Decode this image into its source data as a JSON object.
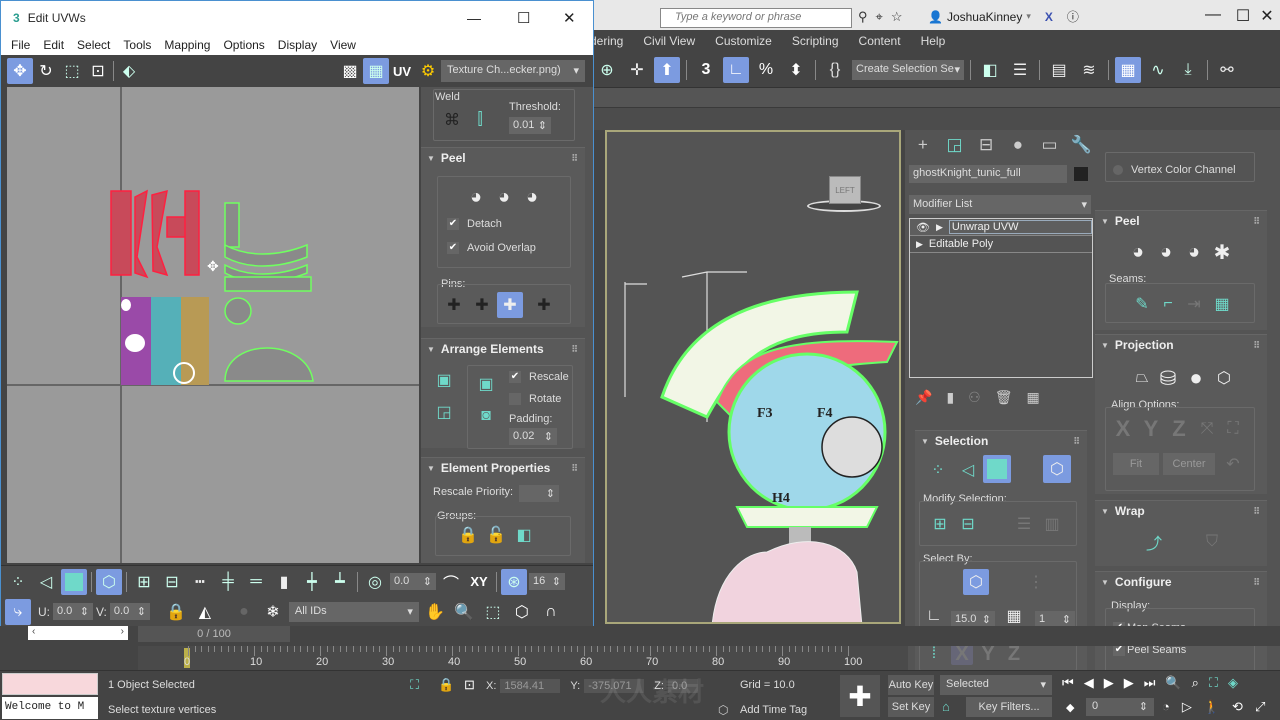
{
  "main": {
    "search_placeholder": "Type a keyword or phrase",
    "user": "JoshuaKinney",
    "menu": [
      "dering",
      "Civil View",
      "Customize",
      "Scripting",
      "Content",
      "Help"
    ],
    "selection_set_placeholder": "Create Selection Se",
    "window_controls": {
      "minimize": "—",
      "maximize": "☐",
      "close": "✕"
    }
  },
  "uvw": {
    "title": "Edit UVWs",
    "menu": [
      "File",
      "Edit",
      "Select",
      "Tools",
      "Mapping",
      "Options",
      "Display",
      "View"
    ],
    "texture_dropdown": "Texture Ch...ecker.png)",
    "uv_label": "UV",
    "weld": {
      "title": "Weld",
      "threshold_label": "Threshold:",
      "threshold": "0.01"
    },
    "peel": {
      "title": "Peel",
      "detach": "Detach",
      "avoid_overlap": "Avoid Overlap",
      "pins_label": "Pins:"
    },
    "arrange": {
      "title": "Arrange Elements",
      "rescale": "Rescale",
      "rotate": "Rotate",
      "padding_label": "Padding:",
      "padding": "0.02"
    },
    "element_props": {
      "title": "Element Properties",
      "rescale_priority": "Rescale Priority:",
      "groups_label": "Groups:"
    },
    "bottom": {
      "rotate_value": "0.0",
      "xy_label": "XY",
      "grid_count": "16",
      "u_label": "U:",
      "u_value": "0.0",
      "v_label": "V:",
      "v_value": "0.0",
      "ids": "All IDs"
    }
  },
  "viewport": {
    "viewcube_label": "LEFT"
  },
  "command_panel": {
    "object_name": "ghostKnight_tunic_full",
    "modifier_list": "Modifier List",
    "stack": [
      "Unwrap UVW",
      "Editable Poly"
    ],
    "selection": {
      "title": "Selection",
      "modify_label": "Modify Selection:",
      "select_by_label": "Select By:",
      "angle": "15.0",
      "count": "1"
    }
  },
  "right_panel": {
    "vertex_color": "Vertex Color Channel",
    "peel": {
      "title": "Peel",
      "seams_label": "Seams:"
    },
    "projection": {
      "title": "Projection",
      "align_label": "Align Options:",
      "fit": "Fit",
      "center": "Center"
    },
    "wrap": {
      "title": "Wrap"
    },
    "configure": {
      "title": "Configure",
      "display_label": "Display:",
      "map_seams": "Map Seams",
      "peel_seams": "Peel Seams"
    }
  },
  "timeline": {
    "frame": "0 / 100",
    "ticks": [
      "0",
      "10",
      "20",
      "30",
      "40",
      "50",
      "60",
      "70",
      "80",
      "90",
      "100"
    ]
  },
  "status": {
    "maxscript": "Welcome to M",
    "selected": "1 Object Selected",
    "prompt": "Select texture vertices",
    "x_label": "X:",
    "x": "1584.41",
    "y_label": "Y:",
    "y": "-375.071",
    "z_label": "Z:",
    "z": "0.0",
    "grid": "Grid = 10.0",
    "add_time_tag": "Add Time Tag",
    "auto_key": "Auto Key",
    "set_key": "Set Key",
    "key_mode": "Selected",
    "key_filters": "Key Filters...",
    "frame_field": "0"
  }
}
